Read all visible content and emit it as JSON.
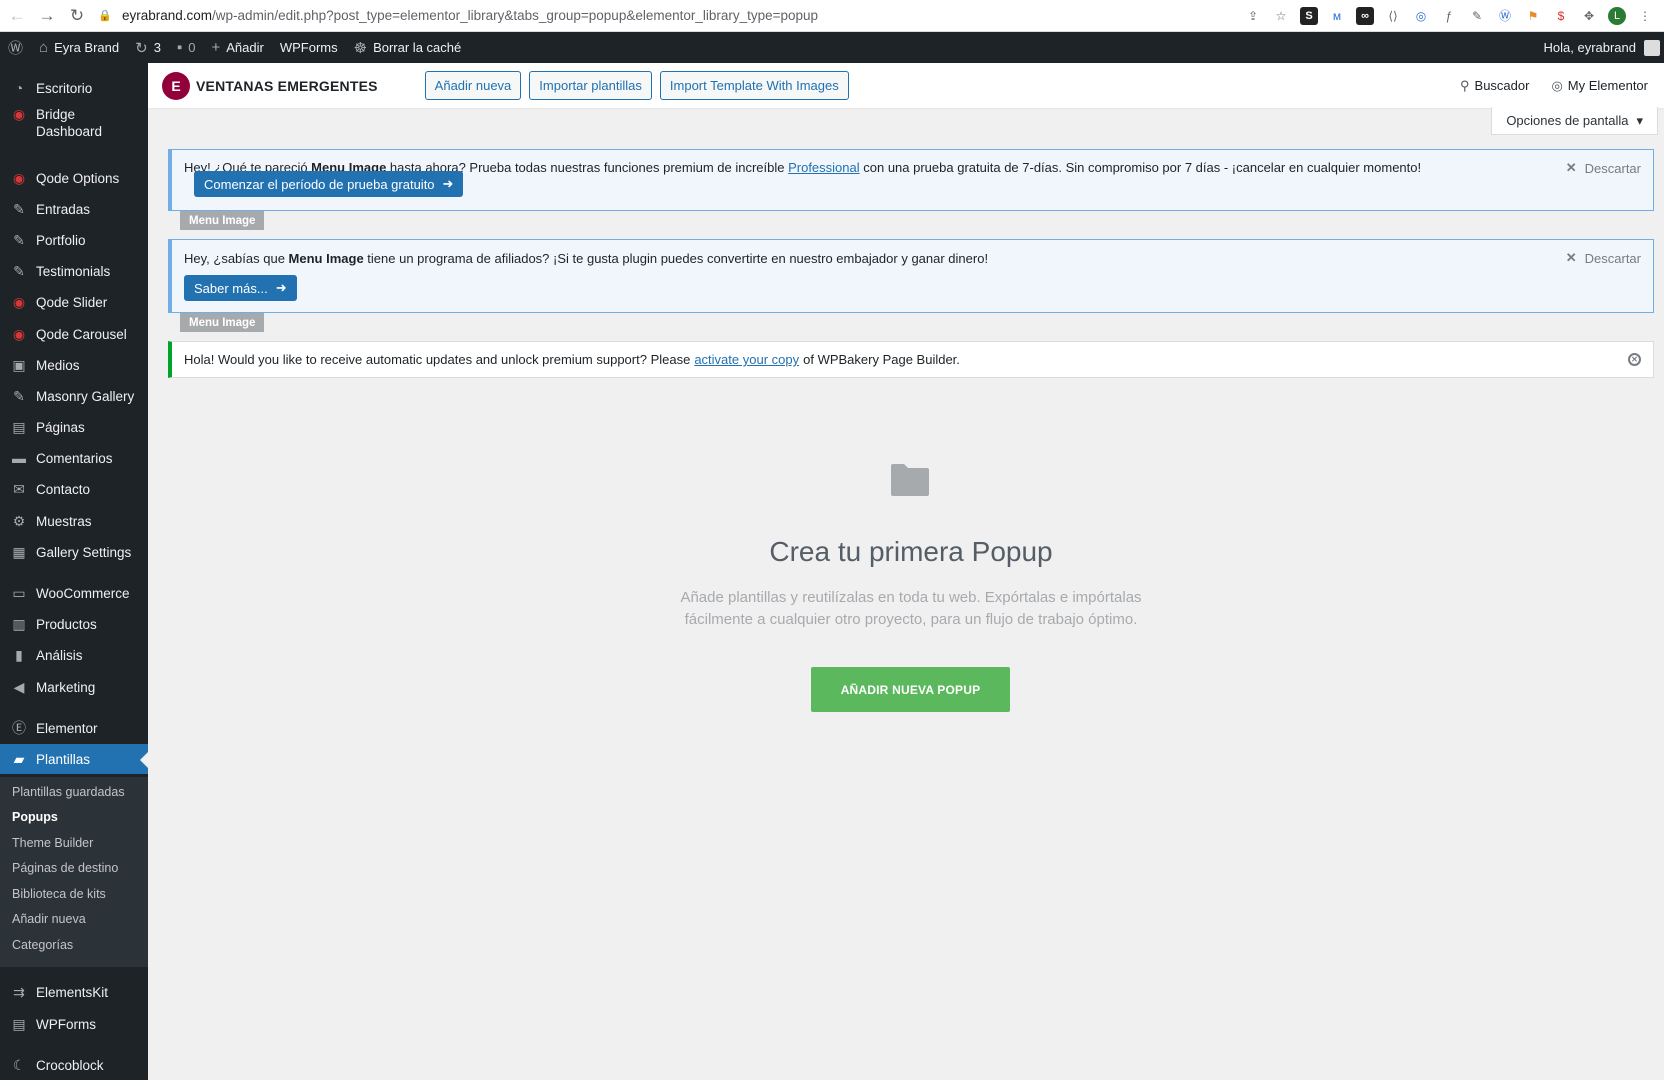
{
  "browser": {
    "url_domain": "eyrabrand.com",
    "url_path": "/wp-admin/edit.php?post_type=elementor_library&tabs_group=popup&elementor_library_type=popup",
    "extensions": [
      "share-icon",
      "star-icon",
      "s-ext",
      "m-ext",
      "oo-ext",
      "code-ext",
      "c-ext",
      "f-ext",
      "pen-ext",
      "wordpress-ext",
      "flag-ext",
      "s-red-ext",
      "puzzle-icon",
      "profile-avatar",
      "menu-dots"
    ],
    "avatar_letter": "L"
  },
  "adminbar": {
    "site_name": "Eyra Brand",
    "updates_count": "3",
    "comments_count": "0",
    "add_new": "Añadir",
    "wpforms": "WPForms",
    "clear_cache": "Borrar la caché",
    "greeting": "Hola, eyrabrand"
  },
  "sidebar": {
    "items": [
      {
        "label": "Escritorio"
      },
      {
        "label": "Bridge Dashboard"
      },
      {
        "label": "Qode Options"
      },
      {
        "label": "Entradas"
      },
      {
        "label": "Portfolio"
      },
      {
        "label": "Testimonials"
      },
      {
        "label": "Qode Slider"
      },
      {
        "label": "Qode Carousel"
      },
      {
        "label": "Medios"
      },
      {
        "label": "Masonry Gallery"
      },
      {
        "label": "Páginas"
      },
      {
        "label": "Comentarios"
      },
      {
        "label": "Contacto"
      },
      {
        "label": "Muestras"
      },
      {
        "label": "Gallery Settings"
      },
      {
        "label": "WooCommerce"
      },
      {
        "label": "Productos"
      },
      {
        "label": "Análisis"
      },
      {
        "label": "Marketing"
      },
      {
        "label": "Elementor"
      },
      {
        "label": "Plantillas"
      },
      {
        "label": "ElementsKit"
      },
      {
        "label": "WPForms"
      },
      {
        "label": "Crocoblock"
      }
    ],
    "submenu": [
      {
        "label": "Plantillas guardadas"
      },
      {
        "label": "Popups"
      },
      {
        "label": "Theme Builder"
      },
      {
        "label": "Páginas de destino"
      },
      {
        "label": "Biblioteca de kits"
      },
      {
        "label": "Añadir nueva"
      },
      {
        "label": "Categorías"
      }
    ]
  },
  "header": {
    "title": "VENTANAS EMERGENTES",
    "btn_add": "Añadir nueva",
    "btn_import": "Importar plantillas",
    "btn_import_images": "Import Template With Images",
    "search": "Buscador",
    "my_elementor": "My Elementor"
  },
  "screen_options": "Opciones de pantalla",
  "notice1": {
    "text_pre": "Hey! ¿Qué te pareció ",
    "text_bold": "Menu Image",
    "text_mid": " hasta ahora? Prueba todas nuestras funciones premium de increíble ",
    "link": "Professional",
    "text_post": " con una prueba gratuita de 7-días. Sin compromiso por 7 días - ¡cancelar en cualquier momento!",
    "button": "Comenzar el período de prueba gratuito",
    "dismiss": "Descartar",
    "tag": "Menu Image"
  },
  "notice2": {
    "text_pre": "Hey, ¿sabías que ",
    "text_bold": "Menu Image",
    "text_post": " tiene un programa de afiliados? ¡Si te gusta plugin puedes convertirte en nuestro embajador y ganar dinero!",
    "button": "Saber más...",
    "dismiss": "Descartar",
    "tag": "Menu Image"
  },
  "notice3": {
    "text_pre": "Hola! Would you like to receive automatic updates and unlock premium support? Please",
    "link": "activate your copy",
    "text_post": "of WPBakery Page Builder."
  },
  "empty": {
    "title": "Crea tu primera Popup",
    "desc1": "Añade plantillas y reutilízalas en toda tu web. Expórtalas e impórtalas",
    "desc2": "fácilmente a cualquier otro proyecto, para un flujo de trabajo óptimo.",
    "button": "AÑADIR NUEVA POPUP"
  }
}
